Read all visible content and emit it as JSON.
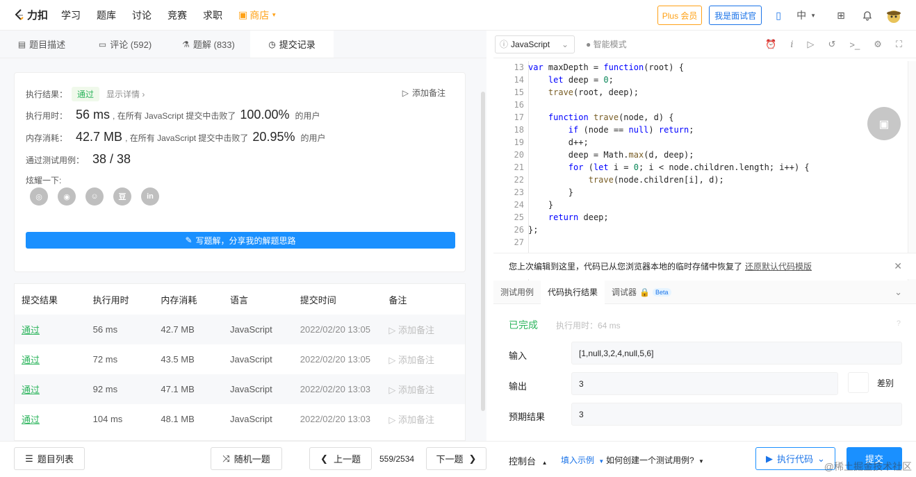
{
  "header": {
    "brand": "力扣",
    "nav": [
      "学习",
      "题库",
      "讨论",
      "竞赛",
      "求职"
    ],
    "store_label": "商店",
    "plus_label": "Plus 会员",
    "interviewer_label": "我是面试官",
    "lang_label": "中"
  },
  "left_tabs": [
    {
      "label": "题目描述",
      "icon": "doc-icon"
    },
    {
      "label": "评论 (592)",
      "icon": "comment-icon"
    },
    {
      "label": "题解 (833)",
      "icon": "flask-icon"
    },
    {
      "label": "提交记录",
      "icon": "clock-icon"
    }
  ],
  "result": {
    "status_label": "执行结果：",
    "status": "通过",
    "detail_link": "显示详情 ›",
    "add_note": "添加备注",
    "runtime_label": "执行用时：",
    "runtime": "56 ms",
    "runtime_text": ", 在所有 JavaScript 提交中击败了",
    "runtime_pct": "100.00%",
    "runtime_suffix": "的用户",
    "memory_label": "内存消耗：",
    "memory": "42.7 MB",
    "memory_text": ", 在所有 JavaScript 提交中击败了",
    "memory_pct": "20.95%",
    "memory_suffix": "的用户",
    "cases_label": "通过测试用例：",
    "cases": "38 / 38",
    "share_label": "炫耀一下:",
    "share_icons": [
      "wechat-icon",
      "weibo-icon",
      "qq-icon",
      "douban-icon",
      "linkedin-icon"
    ],
    "write_button": "写题解，分享我的解题思路"
  },
  "submissions": {
    "headers": [
      "提交结果",
      "执行用时",
      "内存消耗",
      "语言",
      "提交时间",
      "备注"
    ],
    "rows": [
      [
        "通过",
        "56 ms",
        "42.7 MB",
        "JavaScript",
        "2022/02/20 13:05",
        "添加备注"
      ],
      [
        "通过",
        "72 ms",
        "43.5 MB",
        "JavaScript",
        "2022/02/20 13:05",
        "添加备注"
      ],
      [
        "通过",
        "92 ms",
        "47.1 MB",
        "JavaScript",
        "2022/02/20 13:03",
        "添加备注"
      ],
      [
        "通过",
        "104 ms",
        "48.1 MB",
        "JavaScript",
        "2022/02/20 13:03",
        "添加备注"
      ]
    ]
  },
  "editor": {
    "language": "JavaScript",
    "smart_mode": "智能模式",
    "line_numbers": [
      "13",
      "14",
      "15",
      "16",
      "17",
      "18",
      "19",
      "20",
      "21",
      "22",
      "23",
      "24",
      "25",
      "26",
      "27"
    ],
    "notice": "您上次编辑到这里，代码已从您浏览器本地的临时存储中恢复了",
    "notice_link": "还原默认代码模版"
  },
  "console_tabs": [
    "测试用例",
    "代码执行结果",
    "调试器"
  ],
  "beta": "Beta",
  "run_result": {
    "status": "已完成",
    "time": "执行用时：64 ms",
    "input_label": "输入",
    "input": "[1,null,3,2,4,null,5,6]",
    "output_label": "输出",
    "output": "3",
    "diff_label": "差别",
    "expected_label": "预期结果",
    "expected": "3"
  },
  "footer": {
    "list": "题目列表",
    "random": "随机一题",
    "prev": "上一题",
    "page": "559/2534",
    "next": "下一题",
    "console": "控制台",
    "fill_example": "填入示例",
    "howto": "如何创建一个测试用例?",
    "run": "执行代码",
    "submit": "提交",
    "watermark": "@稀土掘金技术社区"
  }
}
